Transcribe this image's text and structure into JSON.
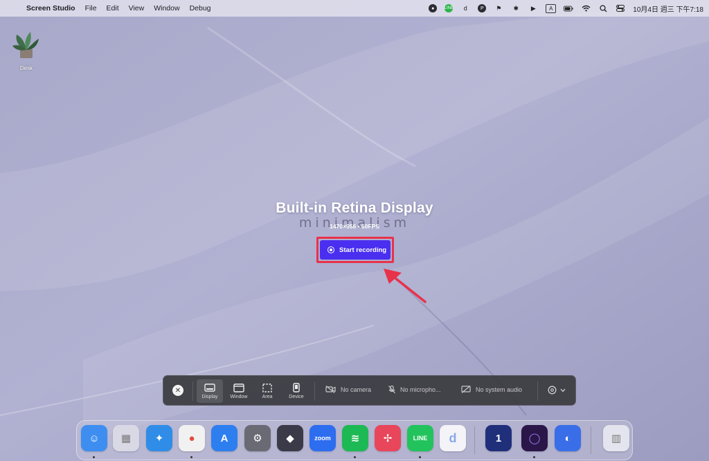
{
  "menubar": {
    "apple_icon": "apple-logo-icon",
    "app_name": "Screen Studio",
    "menus": [
      "File",
      "Edit",
      "View",
      "Window",
      "Debug"
    ],
    "status_icons": [
      "screen-studio-icon",
      "line-icon",
      "d-icon",
      "p-icon",
      "flag-icon",
      "bluetooth-icon",
      "play-icon",
      "input-a-icon",
      "battery-icon",
      "wifi-icon",
      "search-icon",
      "control-center-icon"
    ],
    "input_label": "A",
    "d_label": "d",
    "clock": "10月4日 週三 下午7:18"
  },
  "desktop": {
    "icon_label": "Desk"
  },
  "overlay": {
    "title": "Built-in Retina Display",
    "watermark": "minimalism",
    "subtitle": "1470×956 • 60FPS",
    "record_button": "Start recording",
    "highlight_color": "#e8324a",
    "button_color": "#4a2ff0"
  },
  "toolbar": {
    "modes": [
      {
        "label": "Display",
        "icon": "display-icon",
        "active": true
      },
      {
        "label": "Window",
        "icon": "window-icon",
        "active": false
      },
      {
        "label": "Area",
        "icon": "area-icon",
        "active": false
      },
      {
        "label": "Device",
        "icon": "device-icon",
        "active": false
      }
    ],
    "camera": "No camera",
    "microphone": "No micropho...",
    "system_audio": "No system audio"
  },
  "dock": {
    "apps": [
      {
        "name": "Finder",
        "icon": "finder-icon",
        "color": "#3d8ef0",
        "running": true
      },
      {
        "name": "Launchpad",
        "icon": "launchpad-icon",
        "color": "#d9d9e6",
        "running": false
      },
      {
        "name": "Safari",
        "icon": "safari-icon",
        "color": "#2f8de8",
        "running": false
      },
      {
        "name": "Chrome",
        "icon": "chrome-icon",
        "color": "#f1f1f1",
        "running": true
      },
      {
        "name": "App Store",
        "icon": "app-store-icon",
        "color": "#2d7ff0",
        "running": false
      },
      {
        "name": "System Settings",
        "icon": "settings-icon",
        "color": "#6a6a75",
        "running": false
      },
      {
        "name": "Tiles",
        "icon": "tiles-icon",
        "color": "#3a3a48",
        "running": false
      },
      {
        "name": "Zoom",
        "icon": "zoom-icon",
        "color": "#2d6df0",
        "label": "zoom",
        "running": false
      },
      {
        "name": "Spotify",
        "icon": "spotify-icon",
        "color": "#1db954",
        "running": true
      },
      {
        "name": "Pinwheel",
        "icon": "pinwheel-icon",
        "color": "#e8465a",
        "running": false
      },
      {
        "name": "LINE",
        "icon": "line-app-icon",
        "color": "#22c35c",
        "label": "LINE",
        "running": true
      },
      {
        "name": "Dictionary",
        "icon": "dictionary-icon",
        "color": "#f3f3f8",
        "label": "d",
        "running": false
      },
      {
        "name": "1Password",
        "icon": "onepassword-icon",
        "color": "#1f2f7a",
        "running": false
      },
      {
        "name": "Orb",
        "icon": "orb-icon",
        "color": "#2a1648",
        "running": true
      },
      {
        "name": "CleanMyMac",
        "icon": "cleanmymac-icon",
        "color": "#3a6ee8",
        "running": false
      },
      {
        "name": "Trash",
        "icon": "trash-icon",
        "color": "#e4e4ee",
        "running": false
      }
    ]
  }
}
